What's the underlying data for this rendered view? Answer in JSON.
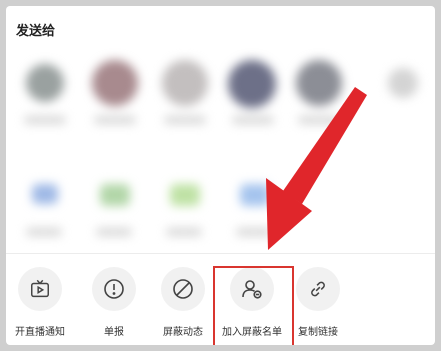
{
  "share_sheet": {
    "title": "发送给",
    "actions": [
      {
        "label": "开直播通知",
        "icon": "tv-icon"
      },
      {
        "label": "单报",
        "icon": "exclamation-circle-icon"
      },
      {
        "label": "屏蔽动态",
        "icon": "block-icon"
      },
      {
        "label": "加入屏蔽名单",
        "icon": "user-block-icon"
      },
      {
        "label": "复制链接",
        "icon": "link-icon"
      }
    ]
  },
  "colors": {
    "highlight": "#d9352f",
    "arrow": "#e0262b"
  }
}
